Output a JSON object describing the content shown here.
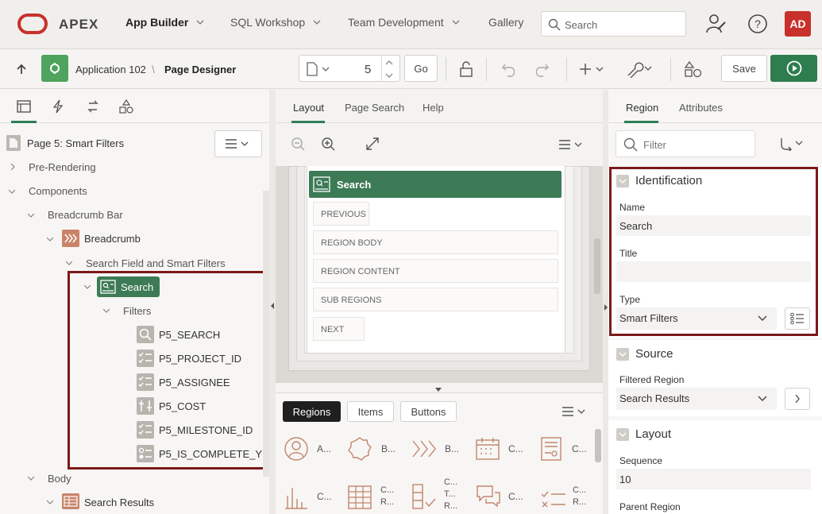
{
  "topbar": {
    "brand": "APEX",
    "nav": [
      {
        "label": "App Builder",
        "active": true
      },
      {
        "label": "SQL Workshop"
      },
      {
        "label": "Team Development"
      },
      {
        "label": "Gallery"
      }
    ],
    "search_placeholder": "Search",
    "avatar": "AD"
  },
  "toolbar": {
    "breadcrumb_app": "Application 102",
    "breadcrumb_sep": "\\",
    "breadcrumb_page": "Page Designer",
    "page_number": "5",
    "go_label": "Go",
    "save_label": "Save"
  },
  "left": {
    "header": "Page 5: Smart Filters",
    "tree": {
      "pre_rendering": "Pre-Rendering",
      "components": "Components",
      "breadcrumb_bar": "Breadcrumb Bar",
      "breadcrumb": "Breadcrumb",
      "search_field_group": "Search Field and Smart Filters",
      "search": "Search",
      "filters": "Filters",
      "items": [
        "P5_SEARCH",
        "P5_PROJECT_ID",
        "P5_ASSIGNEE",
        "P5_COST",
        "P5_MILESTONE_ID",
        "P5_IS_COMPLETE_YN"
      ],
      "body": "Body",
      "search_results": "Search Results"
    }
  },
  "center": {
    "tabs": [
      "Layout",
      "Page Search",
      "Help"
    ],
    "region_title": "Search",
    "rows": [
      "PREVIOUS",
      "REGION BODY",
      "REGION CONTENT",
      "SUB REGIONS",
      "NEXT"
    ],
    "gallery_tabs": [
      "Regions",
      "Items",
      "Buttons"
    ],
    "gallery": [
      {
        "label": "A..."
      },
      {
        "label": "B..."
      },
      {
        "label": "B..."
      },
      {
        "label": "C..."
      },
      {
        "label": "C..."
      },
      {
        "label": "C..."
      },
      {
        "label": "C... R..."
      },
      {
        "label": "C... T... R..."
      },
      {
        "label": "C..."
      },
      {
        "label": "C... R..."
      }
    ]
  },
  "right": {
    "tabs": [
      "Region",
      "Attributes"
    ],
    "filter_placeholder": "Filter",
    "identification": {
      "title": "Identification",
      "name_label": "Name",
      "name_value": "Search",
      "title_label": "Title",
      "title_value": "",
      "type_label": "Type",
      "type_value": "Smart Filters"
    },
    "source": {
      "title": "Source",
      "filtered_label": "Filtered Region",
      "filtered_value": "Search Results"
    },
    "layout": {
      "title": "Layout",
      "sequence_label": "Sequence",
      "sequence_value": "10",
      "parent_label": "Parent Region"
    }
  },
  "colors": {
    "accent": "#2f7d59",
    "run": "#2e7d4f",
    "avatar": "#c8312b",
    "highlight": "#7a1a1a",
    "brand": "#c8312b"
  }
}
